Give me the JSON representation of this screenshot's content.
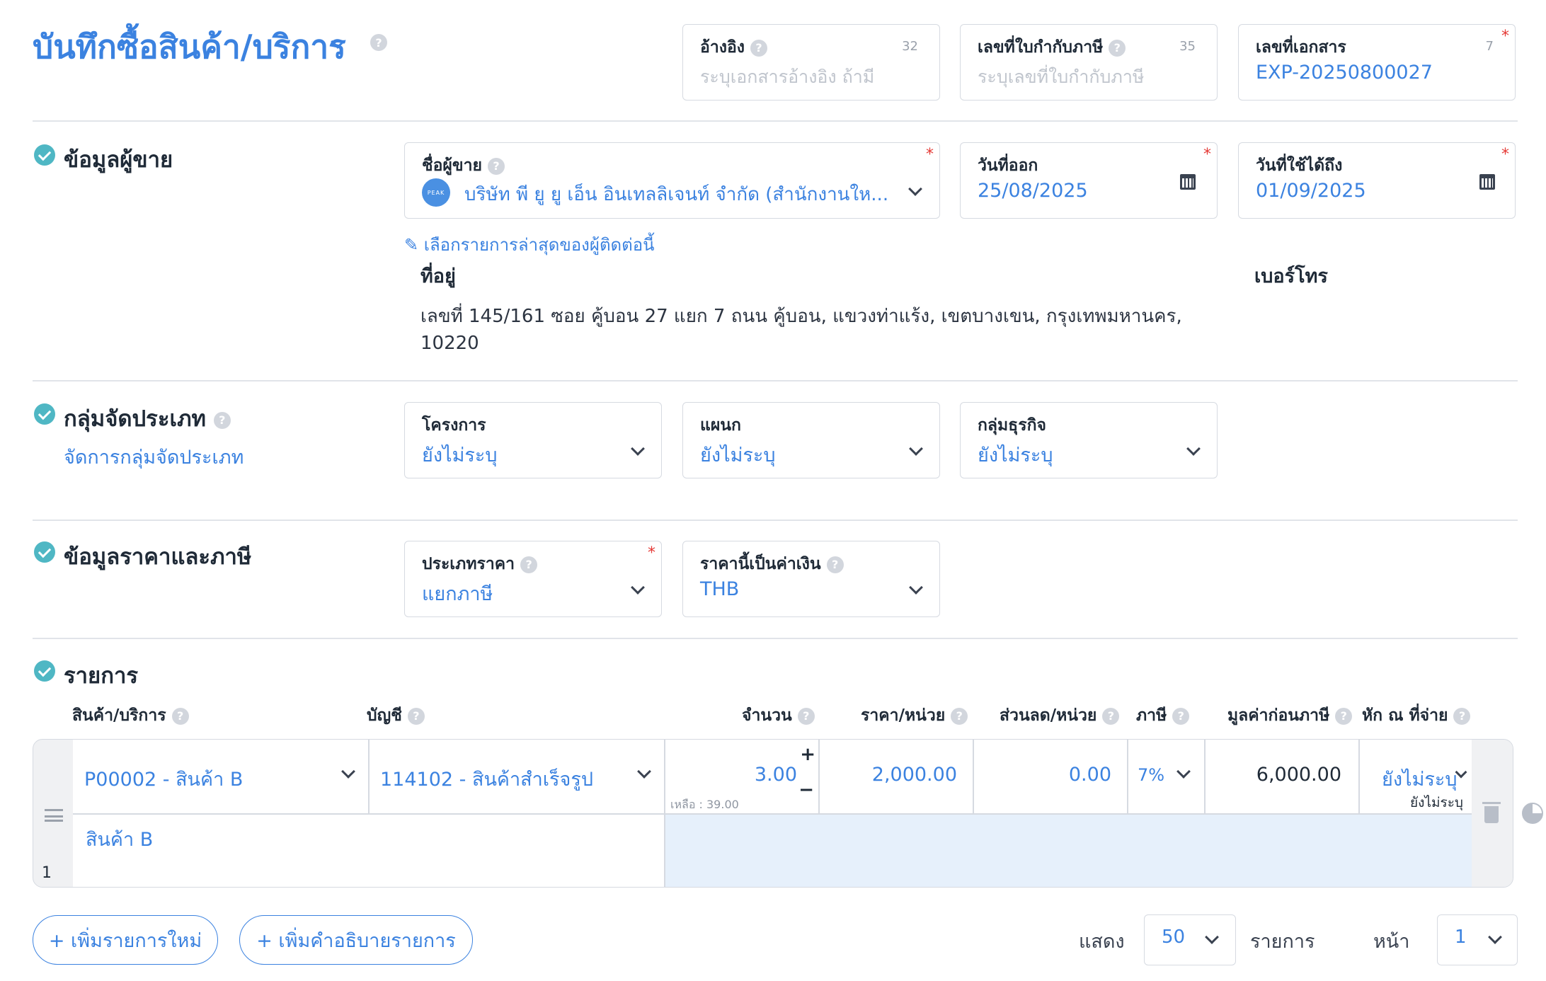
{
  "header": {
    "title": "บันทึกซื้อสินค้า/บริการ",
    "reference": {
      "label": "อ้างอิง",
      "count": "32",
      "placeholder": "ระบุเอกสารอ้างอิง ถ้ามี"
    },
    "tax_invoice": {
      "label": "เลขที่ใบกำกับภาษี",
      "count": "35",
      "placeholder": "ระบุเลขที่ใบกำกับภาษี"
    },
    "doc_number": {
      "label": "เลขที่เอกสาร",
      "count": "7",
      "value": "EXP-20250800027"
    }
  },
  "vendor": {
    "section_title": "ข้อมูลผู้ขาย",
    "name_label": "ชื่อผู้ขาย",
    "logo_text": "PEAK",
    "name_value": "บริษัท พี ยู ยู เอ็น อินเทลลิเจนท์ จำกัด (สำนักงานให...",
    "issue_date_label": "วันที่ออก",
    "issue_date": "25/08/2025",
    "valid_until_label": "วันที่ใช้ได้ถึง",
    "valid_until": "01/09/2025",
    "recent_link": "เลือกรายการล่าสุดของผู้ติดต่อนี้",
    "address_label": "ที่อยู่",
    "address_line1": "เลขที่ 145/161 ซอย คู้บอน 27 แยก 7 ถนน คู้บอน, แขวงท่าแร้ง, เขตบางเขน, กรุงเทพมหานคร,",
    "address_line2": "10220",
    "phone_label": "เบอร์โทร"
  },
  "classification": {
    "section_title": "กลุ่มจัดประเภท",
    "manage_link": "จัดการกลุ่มจัดประเภท",
    "project_label": "โครงการ",
    "project_value": "ยังไม่ระบุ",
    "department_label": "แผนก",
    "department_value": "ยังไม่ระบุ",
    "business_label": "กลุ่มธุรกิจ",
    "business_value": "ยังไม่ระบุ"
  },
  "pricing": {
    "section_title": "ข้อมูลราคาและภาษี",
    "price_type_label": "ประเภทราคา",
    "price_type_value": "แยกภาษี",
    "currency_label": "ราคานี้เป็นค่าเงิน",
    "currency_value": "THB"
  },
  "items": {
    "section_title": "รายการ",
    "columns": {
      "product": "สินค้า/บริการ",
      "account": "บัญชี",
      "quantity": "จำนวน",
      "unit_price": "ราคา/หน่วย",
      "discount": "ส่วนลด/หน่วย",
      "tax": "ภาษี",
      "pre_tax": "มูลค่าก่อนภาษี",
      "withholding": "หัก ณ ที่จ่าย"
    },
    "row": {
      "index": "1",
      "product": "P00002 - สินค้า B",
      "account": "114102 - สินค้าสำเร็จรูป",
      "quantity": "3.00",
      "remaining": "เหลือ : 39.00",
      "unit_price": "2,000.00",
      "discount": "0.00",
      "tax": "7%",
      "pre_tax": "6,000.00",
      "withholding": "ยังไม่ระบุ",
      "withholding_sub": "ยังไม่ระบุ",
      "description": "สินค้า B"
    }
  },
  "footer": {
    "add_item": "+ เพิ่มรายการใหม่",
    "add_description": "+ เพิ่มคำอธิบายรายการ",
    "show_label": "แสดง",
    "page_size": "50",
    "items_label": "รายการ",
    "page_label": "หน้า",
    "page_number": "1"
  },
  "colors": {
    "accent": "#3b82e0",
    "check": "#4fb7c4",
    "required": "#e53935"
  }
}
